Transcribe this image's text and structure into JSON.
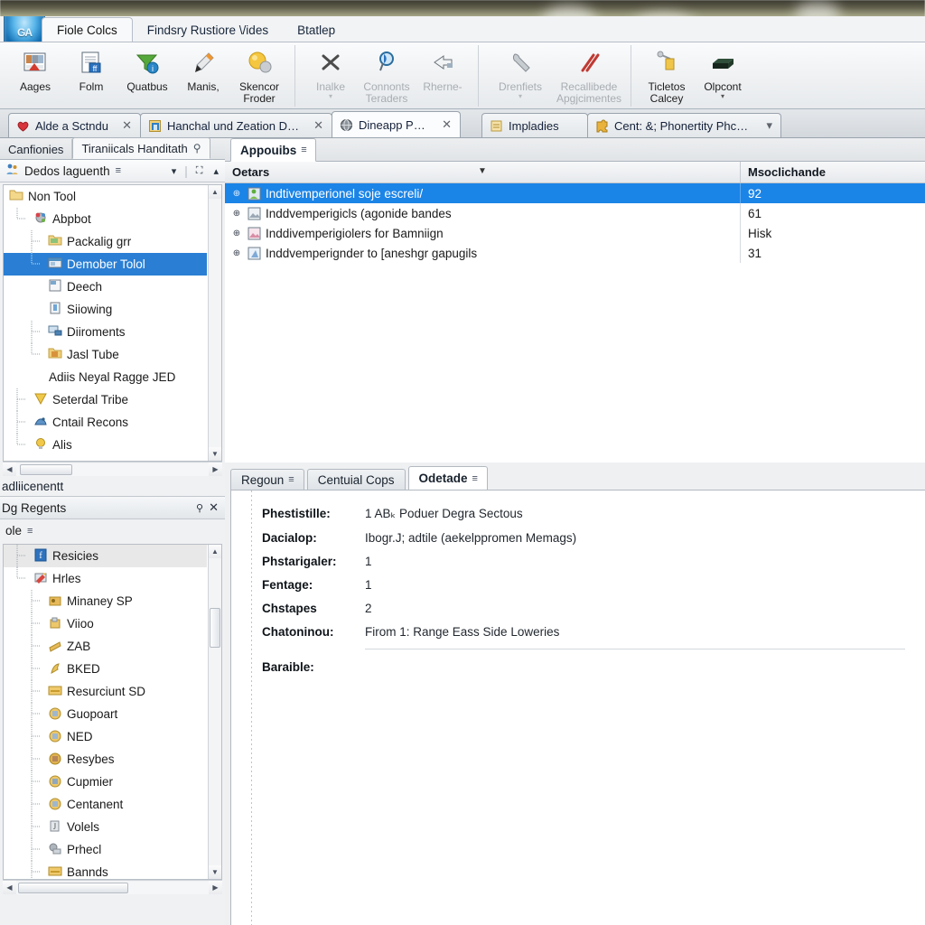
{
  "window": {
    "app_orb_label": "GA"
  },
  "ribbon": {
    "tabs": [
      {
        "label": "Fiole Colcs",
        "active": true
      },
      {
        "label": "Findsry Rustiore \\/ides",
        "active": false
      },
      {
        "label": "Btatlep",
        "active": false
      }
    ],
    "groups": [
      {
        "items": [
          {
            "label": "Aages",
            "icon": "image-stack-icon",
            "dim": false,
            "caret": false
          },
          {
            "label": "Folm",
            "icon": "document-form-icon",
            "dim": false,
            "caret": false
          },
          {
            "label": "Quatbus",
            "icon": "funnel-filter-icon",
            "dim": false,
            "caret": false
          },
          {
            "label": "Manis,",
            "icon": "pen-marker-icon",
            "dim": false,
            "caret": false
          },
          {
            "label": "Skencor Froder",
            "icon": "spheres-icon",
            "dim": false,
            "caret": false
          }
        ]
      },
      {
        "items": [
          {
            "label": "Inalke",
            "icon": "close-cross-icon",
            "dim": true,
            "caret": true
          },
          {
            "label": "Connonts Teraders",
            "icon": "magnifier-icon",
            "dim": true,
            "caret": false
          },
          {
            "label": "Rherne-",
            "icon": "undo-arrow-icon",
            "dim": true,
            "caret": false
          }
        ]
      },
      {
        "items": [
          {
            "label": "Drenfiets",
            "icon": "wrench-icon",
            "dim": true,
            "caret": true
          },
          {
            "label": "Recallibede Apgjcimentes",
            "icon": "red-bars-icon",
            "dim": true,
            "caret": false
          }
        ]
      },
      {
        "items": [
          {
            "label": "Ticletos Calcey",
            "icon": "crane-icon",
            "dim": false,
            "caret": false
          },
          {
            "label": "Olpcont",
            "icon": "green-box-icon",
            "dim": false,
            "caret": true
          }
        ]
      }
    ]
  },
  "tabstrip": {
    "tabs": [
      {
        "label": "Alde a Sctndu",
        "icon": "heart-icon",
        "active": false,
        "closable": true
      },
      {
        "label": "Hanchal und Zeation DFC",
        "icon": "blue-doc-icon",
        "active": false,
        "closable": true
      },
      {
        "label": "Dineapp Pans",
        "icon": "globe-icon",
        "active": true,
        "closable": true
      },
      {
        "label": "Impladies",
        "icon": "note-icon",
        "active": false,
        "closable": false
      },
      {
        "label": "Cent: &; Phonertity Phcentun",
        "icon": "puzzle-icon",
        "active": false,
        "closable": false,
        "caret": true
      }
    ]
  },
  "left_panel": {
    "tabs": [
      {
        "label": "Canfionies",
        "active": false,
        "pin": false
      },
      {
        "label": "Tiraniicals Handitath",
        "active": true,
        "pin": true
      }
    ],
    "tree_header": {
      "title": "Dedos laguenth",
      "icon": "people-icon",
      "menu_icon": "hamburger-icon",
      "caret_icon": "chevron-down-icon",
      "expand_icon": "expand-icon",
      "collapse_icon": "chevron-up-icon"
    },
    "tree": [
      {
        "label": "Non Tool",
        "depth": 0,
        "icon": "folder-icon",
        "state": "normal",
        "twig": "none"
      },
      {
        "label": "Abpbot",
        "depth": 1,
        "icon": "gears-icon",
        "state": "normal",
        "twig": "end"
      },
      {
        "label": "Packalig grr",
        "depth": 2,
        "icon": "folder-green-icon",
        "state": "normal",
        "twig": "tee"
      },
      {
        "label": "Demober Tolol",
        "depth": 2,
        "icon": "window-icon",
        "state": "selected",
        "twig": "end"
      },
      {
        "label": "Deech",
        "depth": 2,
        "icon": "panel-icon",
        "state": "normal",
        "twig": "none"
      },
      {
        "label": "Siiowing",
        "depth": 2,
        "icon": "battery-icon",
        "state": "normal",
        "twig": "none"
      },
      {
        "label": "Diiroments",
        "depth": 2,
        "icon": "network-icon",
        "state": "normal",
        "twig": "tee"
      },
      {
        "label": "Jasl Tube",
        "depth": 2,
        "icon": "folder-open-icon",
        "state": "normal",
        "twig": "end"
      },
      {
        "label": "Adiis Neyal Ragge JED",
        "depth": 3,
        "icon": "none",
        "state": "normal",
        "twig": "none"
      },
      {
        "label": "Seterdal Tribe",
        "depth": 1,
        "icon": "shield-icon",
        "state": "normal",
        "twig": "tee"
      },
      {
        "label": "Cntail Recons",
        "depth": 1,
        "icon": "dog-icon",
        "state": "normal",
        "twig": "tee"
      },
      {
        "label": "Alis",
        "depth": 1,
        "icon": "bulb-icon",
        "state": "normal",
        "twig": "tee"
      }
    ],
    "divider_label": "adliicenentt",
    "sub_panel": {
      "title": "Dg Regents",
      "pin_icon": "pin-icon",
      "close_icon": "close-icon"
    },
    "sub_tree_header": {
      "title": "ole",
      "menu_icon": "hamburger-icon"
    },
    "sub_tree": [
      {
        "label": "Resicies",
        "depth": 1,
        "icon": "blue-f-icon",
        "state": "highlight",
        "twig": "tee"
      },
      {
        "label": "Hrles",
        "depth": 1,
        "icon": "painter-icon",
        "state": "normal",
        "twig": "end"
      },
      {
        "label": "Minaney SP",
        "depth": 2,
        "icon": "lock-yellow-icon",
        "state": "normal",
        "twig": "tee"
      },
      {
        "label": "Viioo",
        "depth": 2,
        "icon": "lock-key-icon",
        "state": "normal",
        "twig": "tee"
      },
      {
        "label": "ZAB",
        "depth": 2,
        "icon": "flag-icon",
        "state": "normal",
        "twig": "tee"
      },
      {
        "label": "BKED",
        "depth": 2,
        "icon": "bird-icon",
        "state": "normal",
        "twig": "tee"
      },
      {
        "label": "Resurciunt SD",
        "depth": 2,
        "icon": "yellow-bar-icon",
        "state": "normal",
        "twig": "tee"
      },
      {
        "label": "Guopoart",
        "depth": 2,
        "icon": "round-lock-icon",
        "state": "normal",
        "twig": "tee"
      },
      {
        "label": "NED",
        "depth": 2,
        "icon": "round-lock-icon",
        "state": "normal",
        "twig": "tee"
      },
      {
        "label": "Resybes",
        "depth": 2,
        "icon": "round-lock-icon",
        "state": "normal",
        "twig": "tee"
      },
      {
        "label": "Cupmier",
        "depth": 2,
        "icon": "round-lock-icon",
        "state": "normal",
        "twig": "tee"
      },
      {
        "label": "Centanent",
        "depth": 2,
        "icon": "round-lock-icon",
        "state": "normal",
        "twig": "tee"
      },
      {
        "label": "Volels",
        "depth": 2,
        "icon": "script-icon",
        "state": "normal",
        "twig": "tee"
      },
      {
        "label": "Prhecl",
        "depth": 2,
        "icon": "gear-stack-icon",
        "state": "normal",
        "twig": "tee"
      },
      {
        "label": "Bannds",
        "depth": 2,
        "icon": "yellow-bar-icon",
        "state": "normal",
        "twig": "tee"
      }
    ]
  },
  "main": {
    "tabs": [
      {
        "label": "Appouibs",
        "active": true,
        "menu_icon": "hamburger-icon"
      }
    ],
    "grid": {
      "columns": [
        {
          "label": "Oetars",
          "sort_caret": true
        },
        {
          "label": "Msoclichande",
          "sort_caret": false
        }
      ],
      "rows": [
        {
          "name": "Indtivemperionel soje escreli/",
          "value": "92",
          "icon": "green-figure-icon",
          "selected": true
        },
        {
          "name": "Inddvemperigicls (agonide bandes",
          "value": "61",
          "icon": "grey-photo-icon",
          "selected": false
        },
        {
          "name": "Inddivemperigiolers for Bamniign",
          "value": "Hisk",
          "icon": "pink-photo-icon",
          "selected": false
        },
        {
          "name": "Inddvemperignder to [aneshgr gapugils",
          "value": "31",
          "icon": "blue-photo-icon",
          "selected": false
        }
      ]
    }
  },
  "detail": {
    "tabs": [
      {
        "label": "Regoun",
        "active": false,
        "menu_icon": "hamburger-icon"
      },
      {
        "label": "Centuial Cops",
        "active": false,
        "menu_icon": "none"
      },
      {
        "label": "Odetade",
        "active": true,
        "menu_icon": "hamburger-icon"
      }
    ],
    "fields": [
      {
        "label": "Phestistille:",
        "value": "1 ABₖ Poduer Degra Sectous"
      },
      {
        "label": "Dacialop:",
        "value": "Ibogr.J; adtile (aekelppromen Memags)"
      },
      {
        "label": "Phstarigaler:",
        "value": "1"
      },
      {
        "label": "Fentage:",
        "value": "1"
      },
      {
        "label": "Chstapes",
        "value": "2"
      },
      {
        "label": "Chatoninou:",
        "value": "Firom 1: Range Eass Side Loweries"
      }
    ],
    "footer_field": {
      "label": "Baraible:",
      "value": ""
    }
  },
  "colors": {
    "selection_blue": "#1b84e7",
    "tree_selection_blue": "#2a7fd4",
    "chrome_grey": "#f0f1f3"
  }
}
